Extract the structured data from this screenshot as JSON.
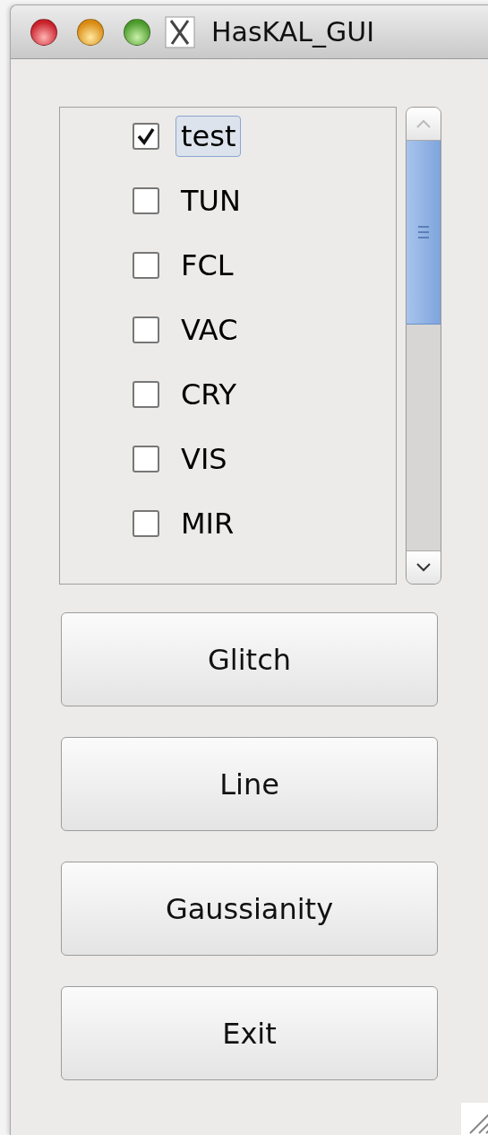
{
  "window": {
    "title": "HasKAL_GUI"
  },
  "list": {
    "items": [
      {
        "label": "test",
        "checked": true,
        "selected": true
      },
      {
        "label": "TUN",
        "checked": false,
        "selected": false
      },
      {
        "label": "FCL",
        "checked": false,
        "selected": false
      },
      {
        "label": "VAC",
        "checked": false,
        "selected": false
      },
      {
        "label": "CRY",
        "checked": false,
        "selected": false
      },
      {
        "label": "VIS",
        "checked": false,
        "selected": false
      },
      {
        "label": "MIR",
        "checked": false,
        "selected": false
      }
    ]
  },
  "buttons": [
    "Glitch",
    "Line",
    "Gaussianity",
    "Exit"
  ]
}
